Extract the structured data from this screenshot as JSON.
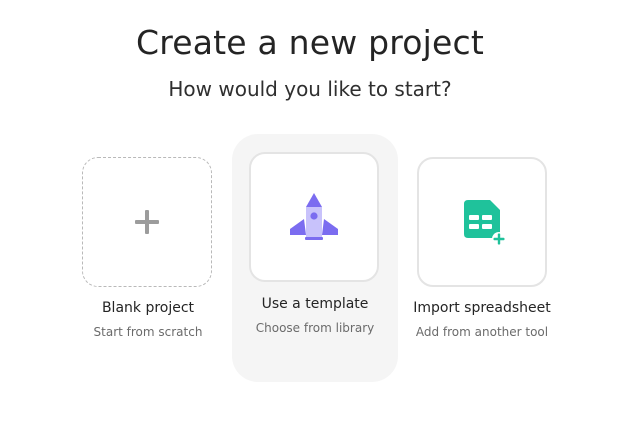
{
  "header": {
    "title": "Create a new project",
    "subtitle": "How would you like to start?"
  },
  "options": [
    {
      "label": "Blank project",
      "description": "Start from scratch",
      "icon": "plus-icon",
      "selected": false
    },
    {
      "label": "Use a template",
      "description": "Choose from library",
      "icon": "rocket-icon",
      "selected": true
    },
    {
      "label": "Import spreadsheet",
      "description": "Add from another tool",
      "icon": "spreadsheet-import-icon",
      "selected": false
    }
  ],
  "colors": {
    "rocket_primary": "#7b6cf0",
    "rocket_light": "#c8c2fb",
    "sheet_green": "#1fc29b",
    "plus_gray": "#9c9c9c",
    "selected_bg": "#f5f5f5"
  }
}
